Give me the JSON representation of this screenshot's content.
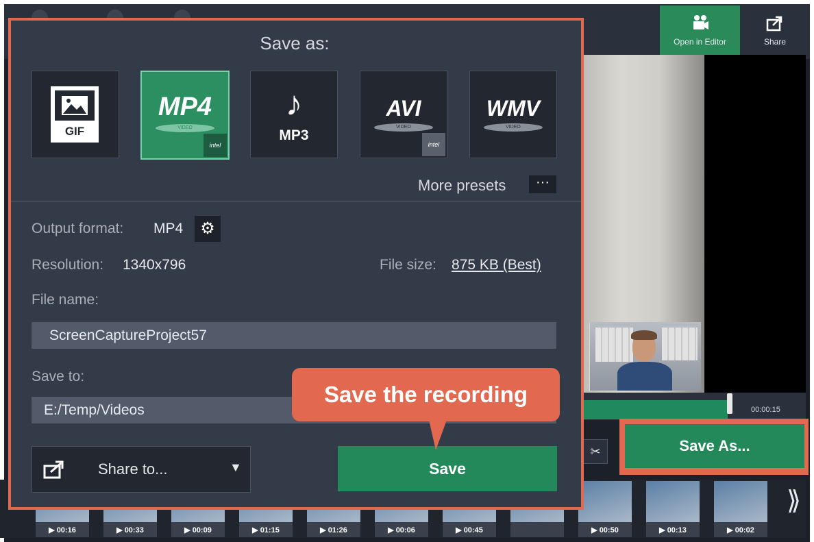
{
  "topbar": {
    "open_in_editor": "Open in Editor",
    "share": "Share"
  },
  "timeline": {
    "time": "00:00:15"
  },
  "main": {
    "save_as_button": "Save As..."
  },
  "thumbnails": [
    {
      "duration": "▶ 00:16"
    },
    {
      "duration": "▶ 00:33"
    },
    {
      "duration": "▶ 00:09"
    },
    {
      "duration": "▶ 01:15"
    },
    {
      "duration": "▶ 01:26"
    },
    {
      "duration": "▶ 00:06"
    },
    {
      "duration": "▶ 00:45"
    },
    {
      "duration": ""
    },
    {
      "duration": "▶ 00:50"
    },
    {
      "duration": "▶ 00:13"
    },
    {
      "duration": "▶ 00:02"
    }
  ],
  "dialog": {
    "title": "Save as:",
    "formats": {
      "gif": "GIF",
      "mp4": "MP4",
      "mp3": "MP3",
      "avi": "AVI",
      "wmv": "WMV",
      "video_tag": "VIDEO",
      "intel_tag": "intel"
    },
    "more_presets": "More presets",
    "more_presets_button": "···",
    "output_format_label": "Output format:",
    "output_format_value": "MP4",
    "resolution_label": "Resolution:",
    "resolution_value": "1340x796",
    "file_size_label": "File size:",
    "file_size_value": "875 KB (Best)",
    "file_name_label": "File name:",
    "file_name_value": "ScreenCaptureProject57",
    "save_to_label": "Save to:",
    "save_to_value": "E:/Temp/Videos",
    "share_to": "Share to...",
    "save_button": "Save"
  },
  "tooltip": {
    "text": "Save the recording"
  },
  "colors": {
    "accent_green": "#24895a",
    "highlight_orange": "#e2684f",
    "dialog_bg": "#343b48"
  }
}
